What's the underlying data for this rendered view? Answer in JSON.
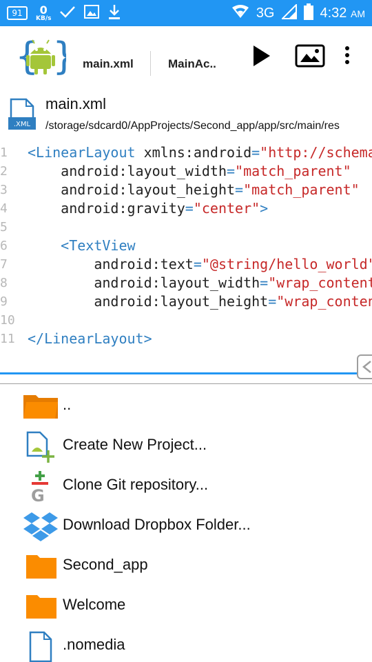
{
  "status_bar": {
    "battery_badge": "91",
    "net_speed": "0",
    "net_speed_unit": "KB/s",
    "network": "3G",
    "time": "4:32",
    "ampm": "AM"
  },
  "app_bar": {
    "tabs": [
      "main.xml",
      "MainAc.."
    ]
  },
  "file": {
    "name": "main.xml",
    "icon_label": ".XML",
    "path": "/storage/sdcard0/AppProjects/Second_app/app/src/main/res"
  },
  "editor": {
    "line_numbers": [
      "1",
      "2",
      "3",
      "4",
      "5",
      "6",
      "7",
      "8",
      "9",
      "10",
      "11"
    ],
    "lines": [
      {
        "t1": "<LinearLayout",
        "a": " xmlns:android",
        "eq": "=",
        "v": "\"http://schemas.android.com/apk/res/android\"",
        "end": ""
      },
      {
        "t1": "",
        "a": "    android:layout_width",
        "eq": "=",
        "v": "\"match_parent\"",
        "end": ""
      },
      {
        "t1": "",
        "a": "    android:layout_height",
        "eq": "=",
        "v": "\"match_parent\"",
        "end": ""
      },
      {
        "t1": "",
        "a": "    android:gravity",
        "eq": "=",
        "v": "\"center\"",
        "end": ">"
      },
      {
        "t1": "",
        "a": "",
        "eq": "",
        "v": "",
        "end": ""
      },
      {
        "t1": "    <TextView",
        "a": "",
        "eq": "",
        "v": "",
        "end": ""
      },
      {
        "t1": "",
        "a": "        android:text",
        "eq": "=",
        "v": "\"@string/hello_world\"",
        "end": ""
      },
      {
        "t1": "",
        "a": "        android:layout_width",
        "eq": "=",
        "v": "\"wrap_content\"",
        "end": ""
      },
      {
        "t1": "",
        "a": "        android:layout_height",
        "eq": "=",
        "v": "\"wrap_content\"",
        "end": ""
      },
      {
        "t1": "",
        "a": "",
        "eq": "",
        "v": "",
        "end": ""
      },
      {
        "t1": "</LinearLayout>",
        "a": "",
        "eq": "",
        "v": "",
        "end": ""
      }
    ]
  },
  "file_list": {
    "items": [
      {
        "label": "..",
        "icon": "folder-open-icon"
      },
      {
        "label": "Create New Project...",
        "icon": "new-project-icon"
      },
      {
        "label": "Clone Git repository...",
        "icon": "git-icon"
      },
      {
        "label": "Download Dropbox Folder...",
        "icon": "dropbox-icon"
      },
      {
        "label": "Second_app",
        "icon": "folder-icon"
      },
      {
        "label": "Welcome",
        "icon": "folder-icon"
      },
      {
        "label": ".nomedia",
        "icon": "file-icon"
      }
    ]
  },
  "colors": {
    "accent": "#2196f3",
    "folder": "#fb8c00",
    "tag": "#2f7fc1",
    "value": "#c62828"
  }
}
